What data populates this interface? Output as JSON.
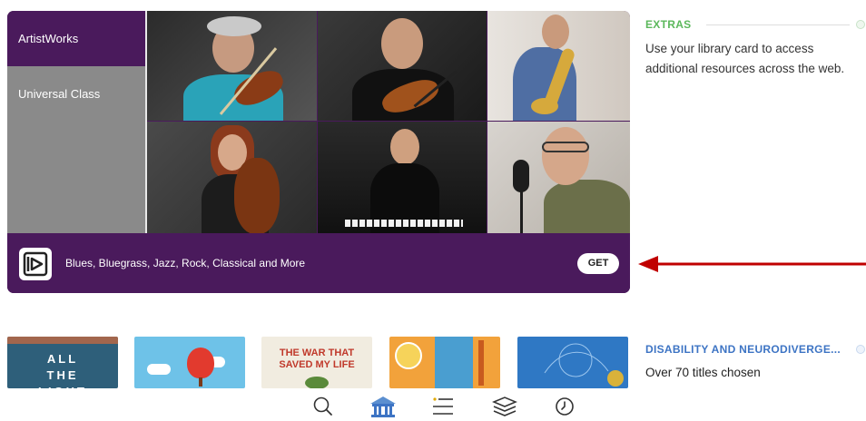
{
  "extras_card": {
    "sidebar": [
      {
        "label": "ArtistWorks",
        "active": true
      },
      {
        "label": "Universal Class",
        "active": false
      }
    ],
    "footer_text": "Blues, Bluegrass, Jazz, Rock, Classical and More",
    "get_label": "GET"
  },
  "extras_section": {
    "title": "EXTRAS",
    "description": "Use your library card to access additional resources across the web."
  },
  "disability_section": {
    "title": "DISABILITY AND NEURODIVERGE...",
    "subtitle": "Over 70 titles chosen"
  },
  "books": [
    {
      "title": "ALL THE LIGHT",
      "color": "#2e5f7a"
    },
    {
      "title": "",
      "color": "#6ec2e8"
    },
    {
      "title": "THE WAR THAT SAVED MY LIFE",
      "color": "#f1ece0"
    },
    {
      "title": "",
      "color": "#f2a23b"
    },
    {
      "title": "",
      "color": "#2f78c4"
    }
  ],
  "colors": {
    "brand_purple": "#4a1a5c",
    "extras_green": "#5cb85c",
    "disability_blue": "#3d74c4",
    "arrow_red": "#c00000"
  },
  "nav_icons": [
    "search-icon",
    "library-icon",
    "menu-icon",
    "shelf-icon",
    "clock-icon"
  ]
}
